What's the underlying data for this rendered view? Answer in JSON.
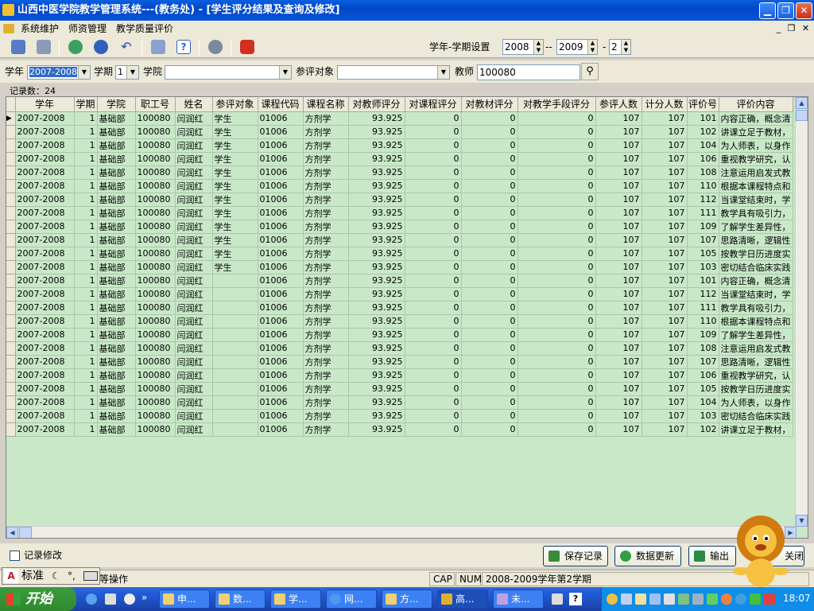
{
  "window": {
    "title": "山西中医学院教学管理系统---(教务处) - [学生评分结果及查询及修改]"
  },
  "menu": [
    "系统维护",
    "师资管理",
    "教学质量评价"
  ],
  "toolbar": {
    "term_label": "学年-学期设置",
    "year_from": "2008",
    "dash": "--",
    "year_to": "2009",
    "sep": "-",
    "term": "2"
  },
  "filter": {
    "year_label": "学年",
    "year_value": "2007-2008",
    "term_label": "学期",
    "term_value": "1",
    "college_label": "学院",
    "college_value": "",
    "target_label": "参评对象",
    "target_value": "",
    "teacher_label": "教师",
    "teacher_value": "100080"
  },
  "record_count": "记录数：24",
  "table": {
    "columns": [
      "学年",
      "学期",
      "学院",
      "职工号",
      "姓名",
      "参评对象",
      "课程代码",
      "课程名称",
      "对教师评分",
      "对课程评分",
      "对教材评分",
      "对教学手段评分",
      "参评人数",
      "计分人数",
      "评价号",
      "评价内容"
    ],
    "rows": [
      [
        "2007-2008",
        "1",
        "基础部",
        "100080",
        "闫润红",
        "学生",
        "01006",
        "方剂学",
        "93.925",
        "0",
        "0",
        "0",
        "107",
        "107",
        "101",
        "内容正确，概念清"
      ],
      [
        "2007-2008",
        "1",
        "基础部",
        "100080",
        "闫润红",
        "学生",
        "01006",
        "方剂学",
        "93.925",
        "0",
        "0",
        "0",
        "107",
        "107",
        "102",
        "讲课立足于教材，"
      ],
      [
        "2007-2008",
        "1",
        "基础部",
        "100080",
        "闫润红",
        "学生",
        "01006",
        "方剂学",
        "93.925",
        "0",
        "0",
        "0",
        "107",
        "107",
        "104",
        "为人师表，以身作"
      ],
      [
        "2007-2008",
        "1",
        "基础部",
        "100080",
        "闫润红",
        "学生",
        "01006",
        "方剂学",
        "93.925",
        "0",
        "0",
        "0",
        "107",
        "107",
        "106",
        "重视教学研究，认"
      ],
      [
        "2007-2008",
        "1",
        "基础部",
        "100080",
        "闫润红",
        "学生",
        "01006",
        "方剂学",
        "93.925",
        "0",
        "0",
        "0",
        "107",
        "107",
        "108",
        "注意运用启发式教"
      ],
      [
        "2007-2008",
        "1",
        "基础部",
        "100080",
        "闫润红",
        "学生",
        "01006",
        "方剂学",
        "93.925",
        "0",
        "0",
        "0",
        "107",
        "107",
        "110",
        "根据本课程特点和"
      ],
      [
        "2007-2008",
        "1",
        "基础部",
        "100080",
        "闫润红",
        "学生",
        "01006",
        "方剂学",
        "93.925",
        "0",
        "0",
        "0",
        "107",
        "107",
        "112",
        "当课堂结束时，学"
      ],
      [
        "2007-2008",
        "1",
        "基础部",
        "100080",
        "闫润红",
        "学生",
        "01006",
        "方剂学",
        "93.925",
        "0",
        "0",
        "0",
        "107",
        "107",
        "111",
        "教学具有吸引力，"
      ],
      [
        "2007-2008",
        "1",
        "基础部",
        "100080",
        "闫润红",
        "学生",
        "01006",
        "方剂学",
        "93.925",
        "0",
        "0",
        "0",
        "107",
        "107",
        "109",
        "了解学生差异性，"
      ],
      [
        "2007-2008",
        "1",
        "基础部",
        "100080",
        "闫润红",
        "学生",
        "01006",
        "方剂学",
        "93.925",
        "0",
        "0",
        "0",
        "107",
        "107",
        "107",
        "思路清晰，逻辑性"
      ],
      [
        "2007-2008",
        "1",
        "基础部",
        "100080",
        "闫润红",
        "学生",
        "01006",
        "方剂学",
        "93.925",
        "0",
        "0",
        "0",
        "107",
        "107",
        "105",
        "按教学日历进度实"
      ],
      [
        "2007-2008",
        "1",
        "基础部",
        "100080",
        "闫润红",
        "学生",
        "01006",
        "方剂学",
        "93.925",
        "0",
        "0",
        "0",
        "107",
        "107",
        "103",
        "密切结合临床实践"
      ],
      [
        "2007-2008",
        "1",
        "基础部",
        "100080",
        "闫润红",
        "",
        "01006",
        "方剂学",
        "93.925",
        "0",
        "0",
        "0",
        "107",
        "107",
        "101",
        "内容正确，概念清"
      ],
      [
        "2007-2008",
        "1",
        "基础部",
        "100080",
        "闫润红",
        "",
        "01006",
        "方剂学",
        "93.925",
        "0",
        "0",
        "0",
        "107",
        "107",
        "112",
        "当课堂结束时，学"
      ],
      [
        "2007-2008",
        "1",
        "基础部",
        "100080",
        "闫润红",
        "",
        "01006",
        "方剂学",
        "93.925",
        "0",
        "0",
        "0",
        "107",
        "107",
        "111",
        "教学具有吸引力，"
      ],
      [
        "2007-2008",
        "1",
        "基础部",
        "100080",
        "闫润红",
        "",
        "01006",
        "方剂学",
        "93.925",
        "0",
        "0",
        "0",
        "107",
        "107",
        "110",
        "根据本课程特点和"
      ],
      [
        "2007-2008",
        "1",
        "基础部",
        "100080",
        "闫润红",
        "",
        "01006",
        "方剂学",
        "93.925",
        "0",
        "0",
        "0",
        "107",
        "107",
        "109",
        "了解学生差异性，"
      ],
      [
        "2007-2008",
        "1",
        "基础部",
        "100080",
        "闫润红",
        "",
        "01006",
        "方剂学",
        "93.925",
        "0",
        "0",
        "0",
        "107",
        "107",
        "108",
        "注意运用启发式教"
      ],
      [
        "2007-2008",
        "1",
        "基础部",
        "100080",
        "闫润红",
        "",
        "01006",
        "方剂学",
        "93.925",
        "0",
        "0",
        "0",
        "107",
        "107",
        "107",
        "思路清晰，逻辑性"
      ],
      [
        "2007-2008",
        "1",
        "基础部",
        "100080",
        "闫润红",
        "",
        "01006",
        "方剂学",
        "93.925",
        "0",
        "0",
        "0",
        "107",
        "107",
        "106",
        "重视教学研究，认"
      ],
      [
        "2007-2008",
        "1",
        "基础部",
        "100080",
        "闫润红",
        "",
        "01006",
        "方剂学",
        "93.925",
        "0",
        "0",
        "0",
        "107",
        "107",
        "105",
        "按教学日历进度实"
      ],
      [
        "2007-2008",
        "1",
        "基础部",
        "100080",
        "闫润红",
        "",
        "01006",
        "方剂学",
        "93.925",
        "0",
        "0",
        "0",
        "107",
        "107",
        "104",
        "为人师表，以身作"
      ],
      [
        "2007-2008",
        "1",
        "基础部",
        "100080",
        "闫润红",
        "",
        "01006",
        "方剂学",
        "93.925",
        "0",
        "0",
        "0",
        "107",
        "107",
        "103",
        "密切结合临床实践"
      ],
      [
        "2007-2008",
        "1",
        "基础部",
        "100080",
        "闫润红",
        "",
        "01006",
        "方剂学",
        "93.925",
        "0",
        "0",
        "0",
        "107",
        "107",
        "102",
        "讲课立足于教材，"
      ]
    ]
  },
  "bottom": {
    "edit_checkbox": "记录修改",
    "save": "保存记录",
    "refresh": "数据更新",
    "export": "输出",
    "close": "关闭"
  },
  "status": {
    "left": "教师等操作",
    "cap": "CAP",
    "num": "NUM",
    "term": "2008-2009学年第2学期"
  },
  "ime": {
    "mode": "标准"
  },
  "taskbar": {
    "start": "开始",
    "tasks": [
      "申...",
      "数...",
      "学...",
      "网...",
      "方...",
      "高...",
      "未..."
    ],
    "clock": "18:07"
  }
}
